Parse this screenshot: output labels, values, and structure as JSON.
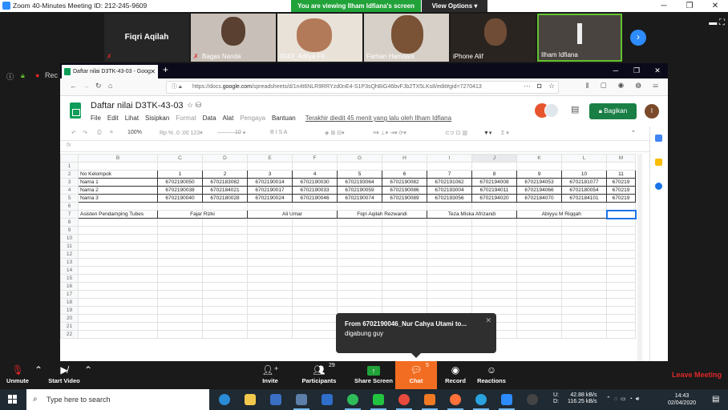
{
  "zoom": {
    "window_title": "Zoom 40-Minutes Meeting ID: 212-245-9609",
    "share_banner": "You are viewing Ilham Idfiana's screen",
    "view_options": "View Options",
    "participants_strip": [
      {
        "name": "Fiqri Aqilah",
        "video": false,
        "muted": true
      },
      {
        "name": "Bagas Nanda",
        "video": true,
        "muted": true
      },
      {
        "name": "0043_Aditya Fir...",
        "video": true,
        "muted": false
      },
      {
        "name": "Farhan Hamdani",
        "video": true,
        "muted": false
      },
      {
        "name": "iPhone Alif",
        "video": true,
        "muted": false
      },
      {
        "name": "Ilham Idfiana",
        "video": true,
        "muted": false,
        "active": true
      }
    ],
    "left_sliver_label": "Rec",
    "bottom_bar": {
      "unmute": "Unmute",
      "start_video": "Start Video",
      "invite": "Invite",
      "participants": "Participants",
      "participants_count": "29",
      "share_screen": "Share Screen",
      "chat": "Chat",
      "chat_count": "5",
      "record": "Record",
      "reactions": "Reactions",
      "leave": "Leave Meeting"
    },
    "chat_popup": {
      "from": "From  6702190046_Nur Cahya Utami  to...",
      "message": "digabung guy"
    }
  },
  "browser": {
    "tab_title": "Daftar nilai D3TK-43-03 - Goog",
    "url_prefix": "https://docs.",
    "url_host": "google.com",
    "url_rest": "/spreadsheets/d/1n4t6NLR9RRYzd0nE4-S1P3sQhBiG46bvFJb2TX5LKs8/edit#gid=7270413"
  },
  "sheets": {
    "title": "Daftar nilai D3TK-43-03",
    "menu": [
      "File",
      "Edit",
      "Lihat",
      "Sisipkan",
      "Format",
      "Data",
      "Alat",
      "Pengaya",
      "Bantuan"
    ],
    "menu_dim": [
      "Format",
      "Pengaya"
    ],
    "last_edit": "Terakhir diedit 45 menit yang lalu oleh Ilham Idfiana",
    "share_button": "Bagikan",
    "user_initial": "I",
    "zoom_level": "100%",
    "font_size": "10",
    "fx_label": "fx",
    "columns": [
      "B",
      "C",
      "D",
      "E",
      "F",
      "G",
      "H",
      "I",
      "J",
      "K",
      "L",
      "M"
    ],
    "rows": [
      {
        "n": "1",
        "cells": []
      },
      {
        "n": "2",
        "cells": [
          "No Kelompok",
          "1",
          "2",
          "3",
          "4",
          "5",
          "6",
          "7",
          "8",
          "9",
          "10",
          "11"
        ]
      },
      {
        "n": "3",
        "cells": [
          "Nama 1",
          "6702190050",
          "6702183082",
          "6702190014",
          "6702190030",
          "6702193064",
          "6702190082",
          "6702191062",
          "6702194008",
          "6702194053",
          "6702181077",
          "670219"
        ]
      },
      {
        "n": "4",
        "cells": [
          "Nama 2",
          "6702190038",
          "6702184021",
          "6702190017",
          "6702190033",
          "6702190059",
          "6702190086",
          "6702193004",
          "6702194011",
          "6702194066",
          "6702180054",
          "670219"
        ]
      },
      {
        "n": "5",
        "cells": [
          "Nama 3",
          "6702190040",
          "6702180028",
          "6702190024",
          "6702190046",
          "6702190074",
          "6702190089",
          "6702193056",
          "6702194020",
          "6702184070",
          "6702184101",
          "670219"
        ]
      },
      {
        "n": "6",
        "cells": []
      }
    ],
    "assistant_row": {
      "n": "7",
      "label": "Asisten Pendamping Tubes",
      "names": [
        "Fajar Rizki",
        "Ali Umar",
        "Fiqri Aqilah Rezwandi",
        "Teza Miska Afrizandi",
        "Abiyyu M Riqqah"
      ]
    },
    "empty_rows": [
      "8",
      "9",
      "10",
      "11",
      "12",
      "13",
      "14",
      "15",
      "16",
      "17",
      "18",
      "19",
      "20",
      "21",
      "22"
    ]
  },
  "taskbar": {
    "search_placeholder": "Type here to search",
    "net_up_label": "U:",
    "net_down_label": "D:",
    "net_up": "42.88 kB/s",
    "net_down": "116.25 kB/s",
    "time": "14:43",
    "date": "02/04/2020"
  }
}
